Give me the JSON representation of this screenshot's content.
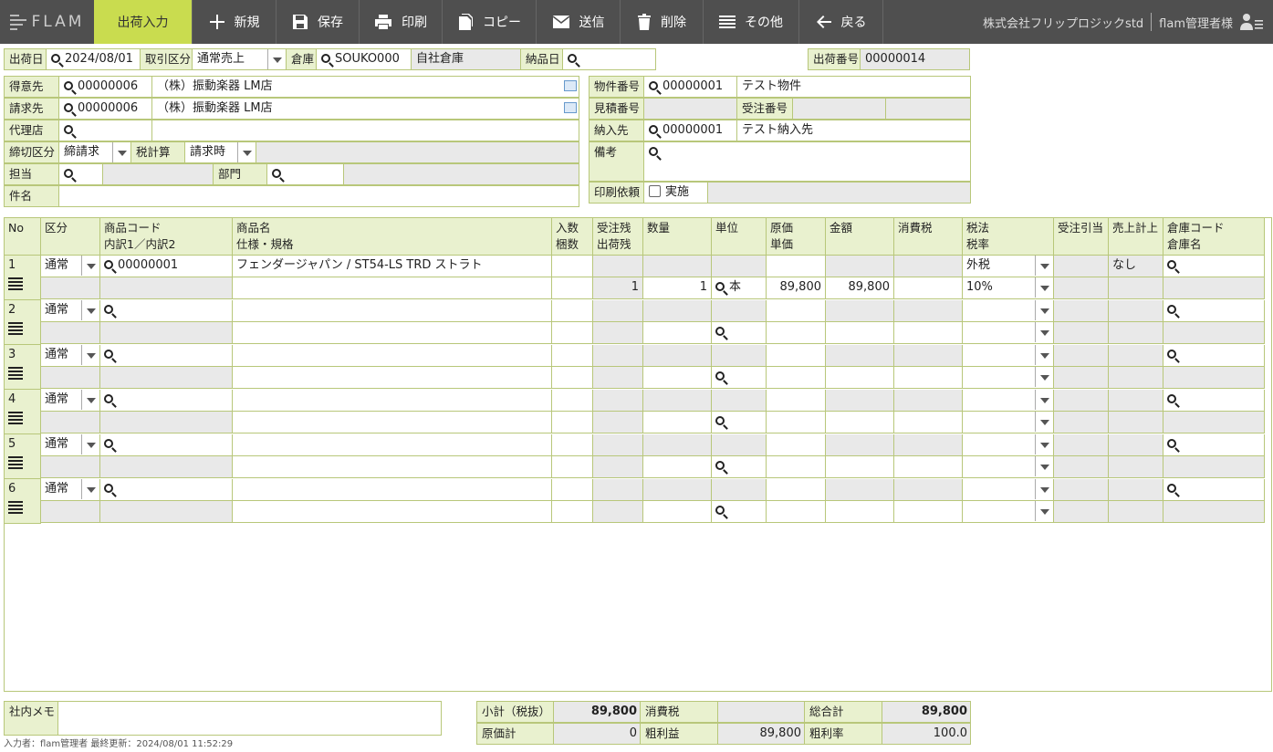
{
  "toolbar": {
    "logo": "FLAM",
    "active_tab": "出荷入力",
    "buttons": {
      "new": "新規",
      "save": "保存",
      "print": "印刷",
      "copy": "コピー",
      "send": "送信",
      "delete": "削除",
      "other": "その他",
      "back": "戻る"
    },
    "company": "株式会社フリップロジックstd",
    "user": "flam管理者様"
  },
  "header": {
    "ship_date_label": "出荷日",
    "ship_date": "2024/08/01",
    "trade_type_label": "取引区分",
    "trade_type": "通常売上",
    "warehouse_label": "倉庫",
    "warehouse_code": "SOUKO000",
    "warehouse_name": "自社倉庫",
    "delivery_date_label": "納品日",
    "delivery_date": "",
    "ship_no_label": "出荷番号",
    "ship_no": "00000014"
  },
  "customer": {
    "customer_label": "得意先",
    "customer_code": "00000006",
    "customer_name": "（株）振動楽器 LM店",
    "billing_label": "請求先",
    "billing_code": "00000006",
    "billing_name": "（株）振動楽器 LM店",
    "agent_label": "代理店",
    "agent_code": "",
    "closing_label": "締切区分",
    "closing": "締請求",
    "tax_calc_label": "税計算",
    "tax_calc": "請求時",
    "staff_label": "担当",
    "staff": "",
    "dept_label": "部門",
    "dept": "",
    "subject_label": "件名",
    "subject": ""
  },
  "project": {
    "project_no_label": "物件番号",
    "project_no": "00000001",
    "project_name": "テスト物件",
    "estimate_label": "見積番号",
    "estimate": "",
    "order_label": "受注番号",
    "order": "",
    "delivery_to_label": "納入先",
    "delivery_to_code": "00000001",
    "delivery_to_name": "テスト納入先",
    "remarks_label": "備考",
    "remarks": "",
    "print_req_label": "印刷依頼",
    "print_req_option": "実施"
  },
  "grid": {
    "headers": {
      "no": "No",
      "kubun": "区分",
      "code1": "商品コード",
      "code2": "内訳1／内訳2",
      "name1": "商品名",
      "name2": "仕様・規格",
      "irisu1": "入数",
      "irisu2": "梱数",
      "zan1": "受注残",
      "zan2": "出荷残",
      "qty": "数量",
      "unit": "単位",
      "cost1": "原価",
      "cost2": "単価",
      "amount": "金額",
      "tax": "消費税",
      "taxlaw1": "税法",
      "taxlaw2": "税率",
      "juchu": "受注引当",
      "uriage": "売上計上",
      "wh1": "倉庫コード",
      "wh2": "倉庫名"
    },
    "rows": [
      {
        "no": "1",
        "kubun": "通常",
        "code": "00000001",
        "name": "フェンダージャパン / ST54-LS TRD ストラト",
        "zan": "1",
        "qty": "1",
        "unit": "本",
        "price": "89,800",
        "amount": "89,800",
        "taxlaw": "外税",
        "taxrate": "10%",
        "uriage": "なし"
      },
      {
        "no": "2",
        "kubun": "通常",
        "code": "",
        "name": "",
        "zan": "",
        "qty": "",
        "unit": "",
        "price": "",
        "amount": "",
        "taxlaw": "",
        "taxrate": "",
        "uriage": ""
      },
      {
        "no": "3",
        "kubun": "通常",
        "code": "",
        "name": "",
        "zan": "",
        "qty": "",
        "unit": "",
        "price": "",
        "amount": "",
        "taxlaw": "",
        "taxrate": "",
        "uriage": ""
      },
      {
        "no": "4",
        "kubun": "通常",
        "code": "",
        "name": "",
        "zan": "",
        "qty": "",
        "unit": "",
        "price": "",
        "amount": "",
        "taxlaw": "",
        "taxrate": "",
        "uriage": ""
      },
      {
        "no": "5",
        "kubun": "通常",
        "code": "",
        "name": "",
        "zan": "",
        "qty": "",
        "unit": "",
        "price": "",
        "amount": "",
        "taxlaw": "",
        "taxrate": "",
        "uriage": ""
      },
      {
        "no": "6",
        "kubun": "通常",
        "code": "",
        "name": "",
        "zan": "",
        "qty": "",
        "unit": "",
        "price": "",
        "amount": "",
        "taxlaw": "",
        "taxrate": "",
        "uriage": ""
      }
    ]
  },
  "footer": {
    "memo_label": "社内メモ",
    "memo": "",
    "subtotal_label": "小計（税抜）",
    "subtotal": "89,800",
    "tax_label": "消費税",
    "tax": "",
    "total_label": "総合計",
    "total": "89,800",
    "cost_label": "原価計",
    "cost": "0",
    "profit_label": "粗利益",
    "profit": "89,800",
    "margin_label": "粗利率",
    "margin": "100.0",
    "meta": "入力者：flam管理者 最終更新：2024/08/01 11:52:29"
  }
}
